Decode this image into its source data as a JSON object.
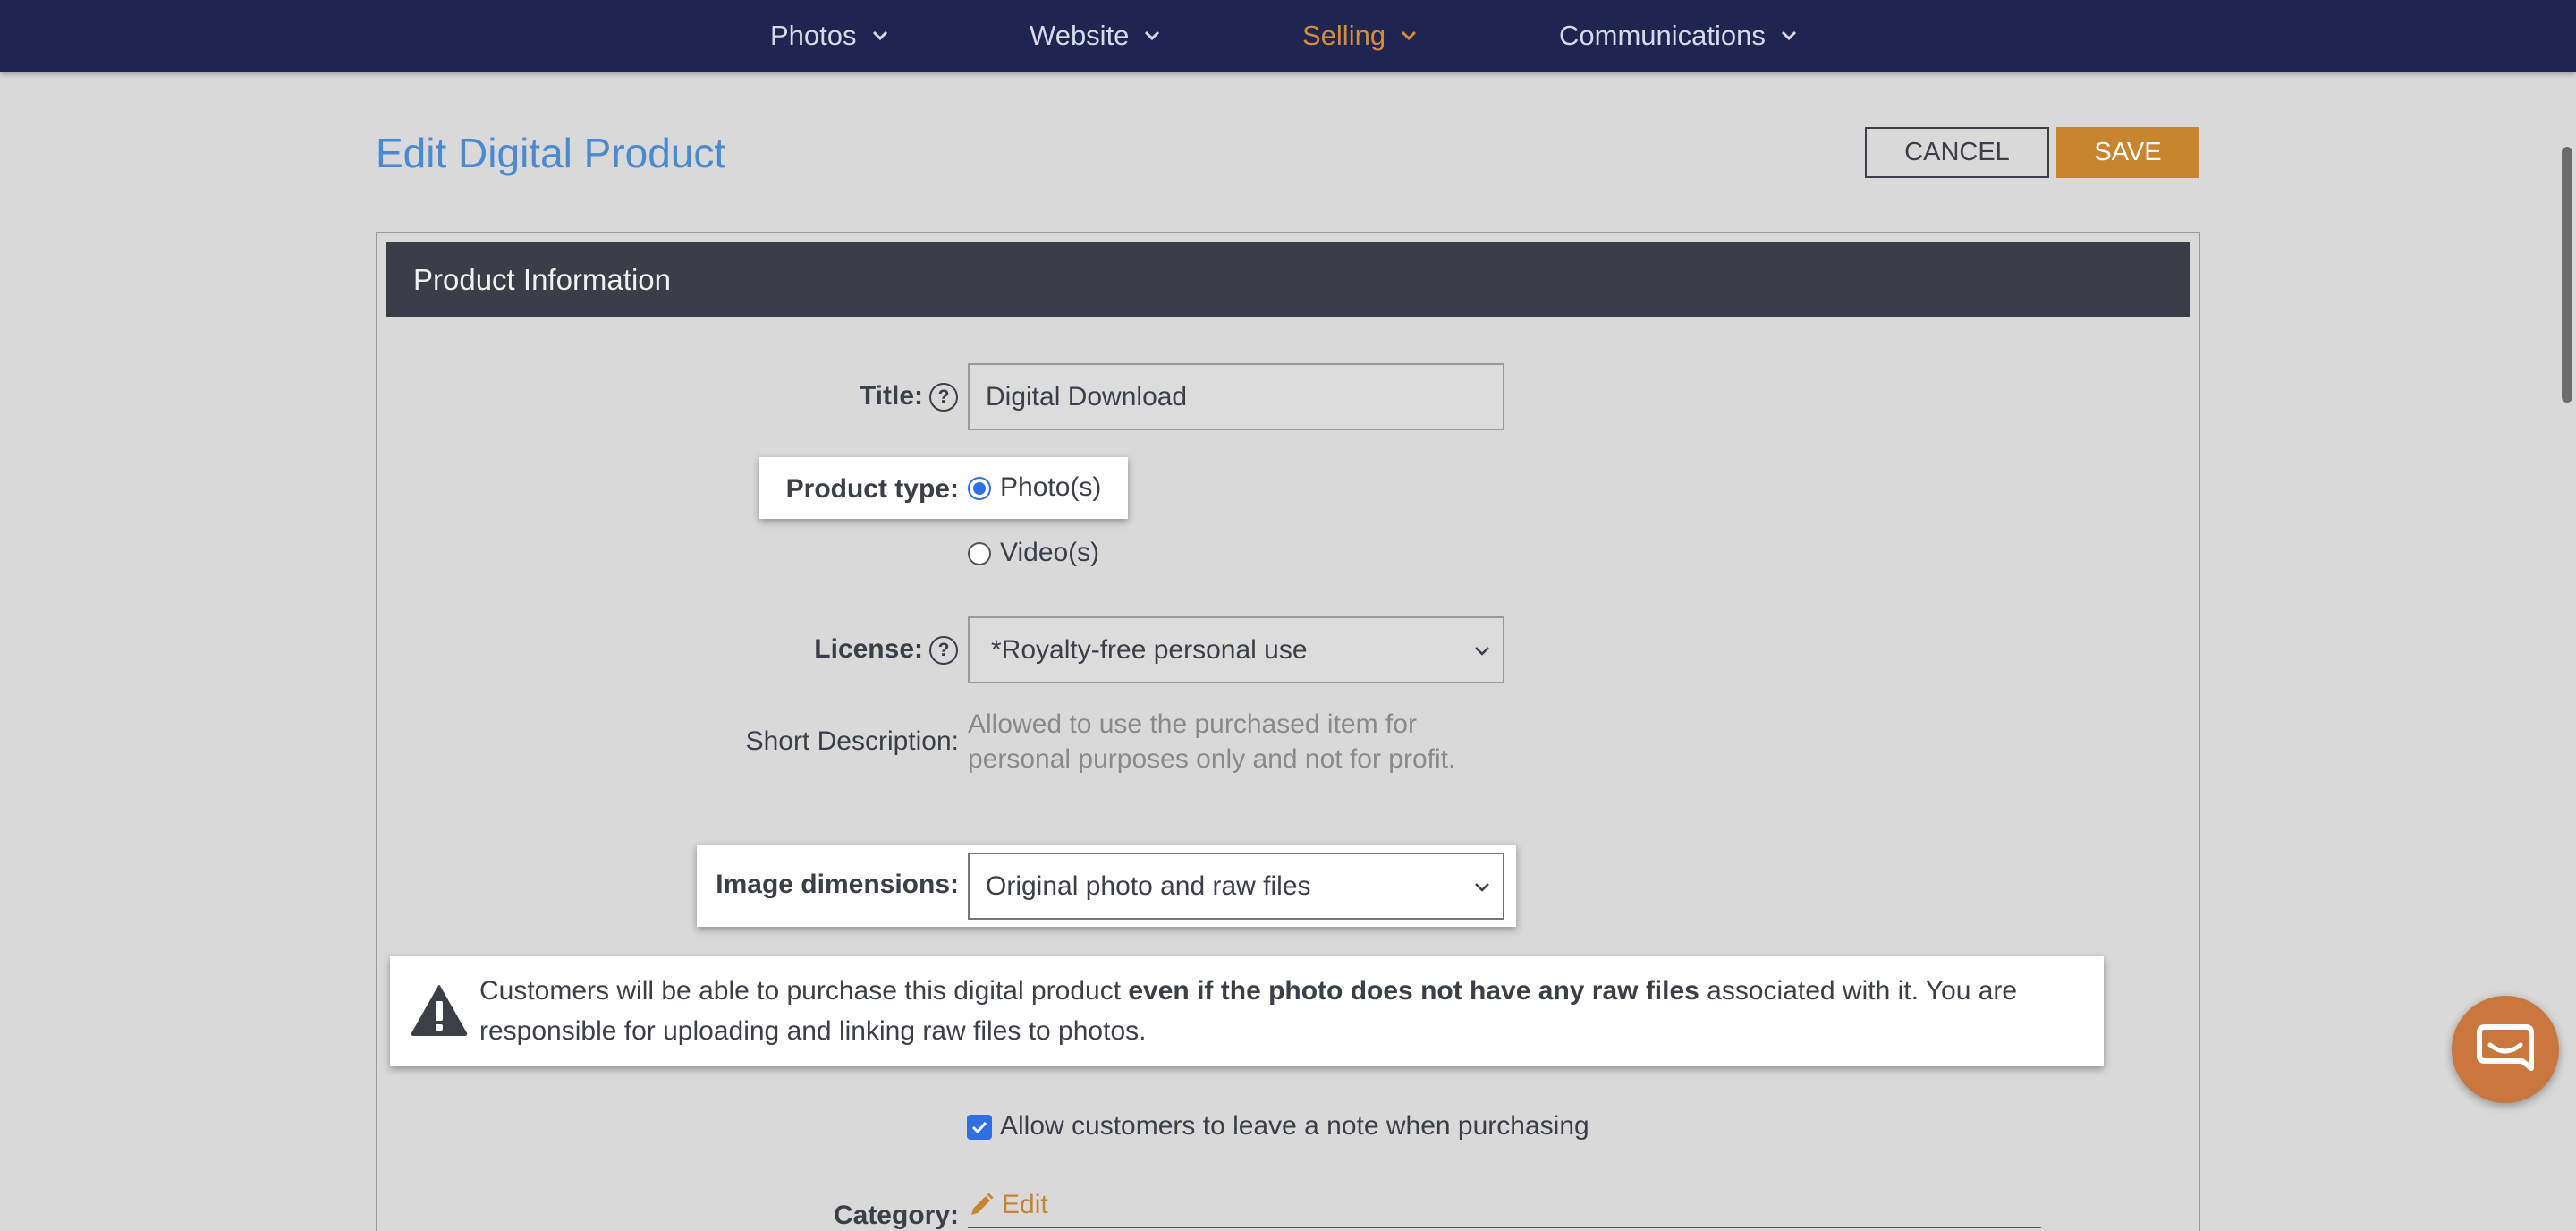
{
  "nav": {
    "items": [
      {
        "label": "Photos"
      },
      {
        "label": "Website"
      },
      {
        "label": "Selling"
      },
      {
        "label": "Communications"
      }
    ]
  },
  "colors": {
    "nav_bg": "#1d2550",
    "accent": "#c9842f",
    "title_blue": "#4a8ad0",
    "panel_header": "#3b3e48",
    "checked_blue": "#2f6fe0"
  },
  "header": {
    "title": "Edit Digital Product",
    "cancel_label": "CANCEL",
    "save_label": "SAVE"
  },
  "panel": {
    "title": "Product Information"
  },
  "form": {
    "title_label": "Title:",
    "title_value": "Digital Download",
    "product_type_label": "Product type:",
    "product_type_options": [
      "Photo(s)",
      "Video(s)"
    ],
    "product_type_selected": "Photo(s)",
    "license_label": "License:",
    "license_value": "*Royalty-free personal use",
    "short_desc_label": "Short Description:",
    "short_desc_value": "Allowed to use the purchased item for personal purposes only and not for profit.",
    "image_dim_label": "Image dimensions:",
    "image_dim_value": "Original photo and raw files",
    "warning_pre": "Customers will be able to purchase this digital product ",
    "warning_bold": "even if the photo does not have any raw files",
    "warning_post": " associated with it. You are responsible for uploading and linking raw files to photos.",
    "allow_note_label": "Allow customers to leave a note when purchasing",
    "allow_note_checked": true,
    "category_label": "Category:",
    "edit_label": "Edit"
  },
  "icons": {
    "help": "question-circle-icon",
    "warning": "warning-triangle-icon",
    "chevron": "chevron-down-icon",
    "pencil": "pencil-icon",
    "chat": "chat-bubble-icon"
  }
}
